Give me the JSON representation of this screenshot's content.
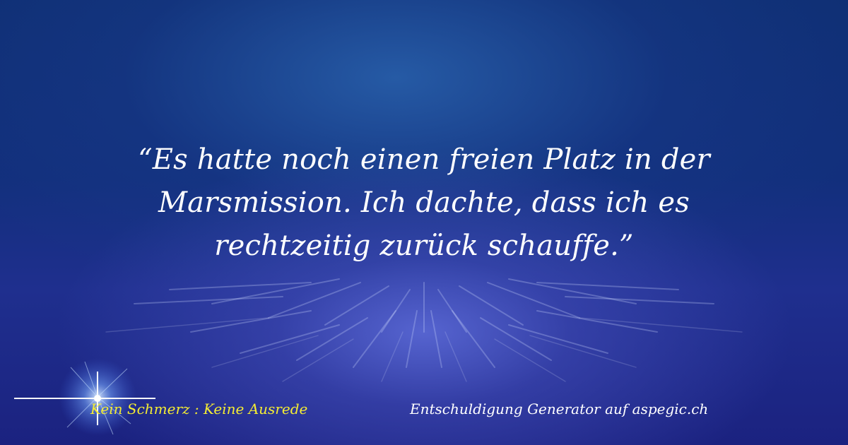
{
  "quote": {
    "line1": "“Es hatte noch einen freien Platz in der",
    "line2": "Marsmission. Ich dachte, dass ich es",
    "line3": "rechtzeitig zurück schauffe.”"
  },
  "footer": {
    "tagline": "Kein Schmerz : Keine Ausrede",
    "credit": "Entschuldigung Generator auf aspegic.ch"
  },
  "colors": {
    "background_top": "#0f2f74",
    "background_glow": "#606edc",
    "quote_text": "#ffffff",
    "tagline_text": "#f4ec33"
  },
  "icons": {
    "logo": "star-sparkle-icon"
  }
}
